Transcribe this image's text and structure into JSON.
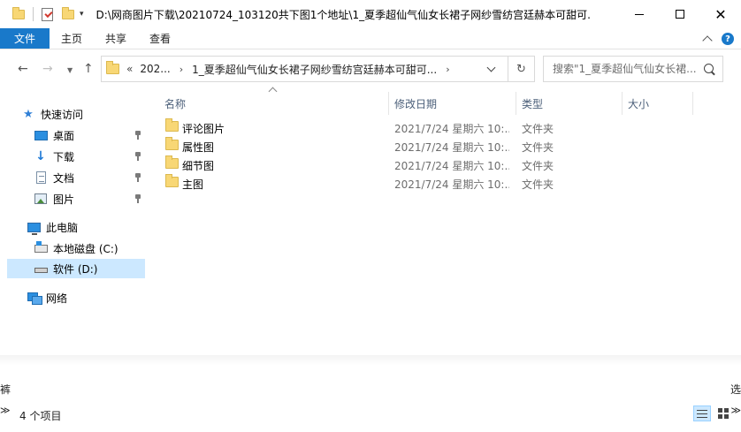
{
  "window": {
    "title": "D:\\网商图片下载\\20210724_103120共下图1个地址\\1_夏季超仙气仙女长裙子网纱雪纺宫廷赫本可甜可..."
  },
  "ribbon": {
    "tabs": [
      "文件",
      "主页",
      "共享",
      "查看"
    ]
  },
  "address": {
    "overflow": "«",
    "crumbs": [
      "202...",
      "1_夏季超仙气仙女长裙子网纱雪纺宫廷赫本可甜可..."
    ]
  },
  "search": {
    "placeholder": "搜索\"1_夏季超仙气仙女长裙..."
  },
  "sidebar": {
    "quick_access": "快速访问",
    "items": [
      "桌面",
      "下载",
      "文档",
      "图片"
    ],
    "this_pc": "此电脑",
    "drives": [
      "本地磁盘 (C:)",
      "软件 (D:)"
    ],
    "network": "网络"
  },
  "columns": {
    "name": "名称",
    "date": "修改日期",
    "type": "类型",
    "size": "大小"
  },
  "files": [
    {
      "name": "评论图片",
      "date": "2021/7/24 星期六 10:...",
      "type": "文件夹"
    },
    {
      "name": "属性图",
      "date": "2021/7/24 星期六 10:...",
      "type": "文件夹"
    },
    {
      "name": "细节图",
      "date": "2021/7/24 星期六 10:...",
      "type": "文件夹"
    },
    {
      "name": "主图",
      "date": "2021/7/24 星期六 10:...",
      "type": "文件夹"
    }
  ],
  "status": {
    "count": "4 个项目"
  },
  "bleed_text": {
    "left_top": "裤",
    "right_top": "选",
    "left_mid": "≫",
    "right_mid": "≫"
  }
}
